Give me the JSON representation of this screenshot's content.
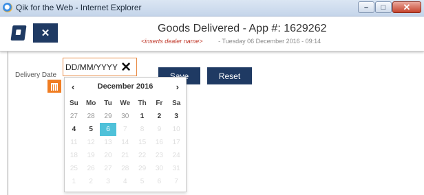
{
  "window": {
    "title": "Qik for the Web - Internet Explorer"
  },
  "header": {
    "title": "Goods Delivered - App #: 1629262",
    "dealer": "<inserts dealer name>",
    "date": "- Tuesday 06 December 2016 - 09:14"
  },
  "form": {
    "delivery_label": "Delivery Date",
    "date_placeholder": "DD/MM/YYYY",
    "save": "Save",
    "reset": "Reset"
  },
  "datepicker": {
    "month": "December 2016",
    "prev": "‹",
    "next": "›",
    "weekdays": [
      "Su",
      "Mo",
      "Tu",
      "We",
      "Th",
      "Fr",
      "Sa"
    ],
    "weeks": [
      [
        "27",
        "28",
        "29",
        "30",
        "1",
        "2",
        "3"
      ],
      [
        "4",
        "5",
        "6",
        "7",
        "8",
        "9",
        "10"
      ],
      [
        "11",
        "12",
        "13",
        "14",
        "15",
        "16",
        "17"
      ],
      [
        "18",
        "19",
        "20",
        "21",
        "22",
        "23",
        "24"
      ],
      [
        "25",
        "26",
        "27",
        "28",
        "29",
        "30",
        "31"
      ],
      [
        "1",
        "2",
        "3",
        "4",
        "5",
        "6",
        "7"
      ]
    ],
    "selected": "6"
  },
  "icons": {
    "close_app": "close-icon",
    "calendar": "calendar-icon",
    "clear": "clear-icon"
  },
  "colors": {
    "brand": "#1f3a63",
    "accent": "#f07d22",
    "selected": "#4fc1d9"
  }
}
